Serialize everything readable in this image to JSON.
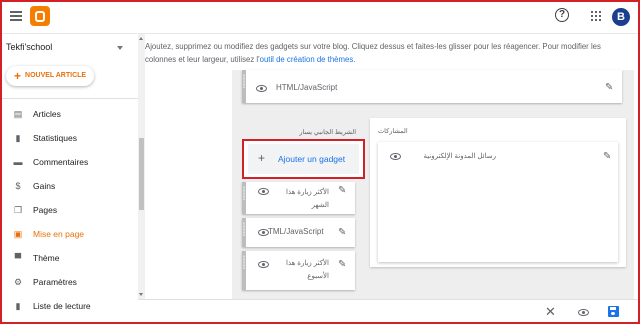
{
  "header": {
    "avatar_letter": "B"
  },
  "sidebar": {
    "blog_name": "Tekfi'school",
    "new_post_label": "NOUVEL ARTICLE",
    "items": [
      {
        "label": "Articles",
        "icon": "articles-icon"
      },
      {
        "label": "Statistiques",
        "icon": "stats-icon"
      },
      {
        "label": "Commentaires",
        "icon": "comments-icon"
      },
      {
        "label": "Gains",
        "icon": "dollar-icon"
      },
      {
        "label": "Pages",
        "icon": "pages-icon"
      },
      {
        "label": "Mise en page",
        "icon": "layout-icon",
        "active": true
      },
      {
        "label": "Thème",
        "icon": "paint-roller-icon"
      },
      {
        "label": "Paramètres",
        "icon": "gear-icon"
      },
      {
        "label": "Liste de lecture",
        "icon": "bookmark-icon"
      }
    ]
  },
  "main": {
    "intro_text": "Ajoutez, supprimez ou modifiez des gadgets sur votre blog. Cliquez dessus et faites-les glisser pour les réagencer. Pour modifier les colonnes et leur largeur, utilisez l'",
    "intro_link": "outil de création de thèmes",
    "intro_end": ".",
    "top_gadget": "HTML/JavaScript",
    "left_sidebar_title": "الشريط الجانبي يسار",
    "add_gadget_label": "Ajouter un gadget",
    "left_gadgets": [
      "الأكثر زيارة هذا الشهر",
      "TML/JavaScript",
      "الأكثر زيارة هذا الأسبوع"
    ],
    "posts_title": "المشاركات",
    "posts_gadget": "رسائل المدونة الإلكترونية"
  },
  "colors": {
    "accent": "#e8710a",
    "highlight_border": "#d32027",
    "link": "#1a73e8"
  }
}
